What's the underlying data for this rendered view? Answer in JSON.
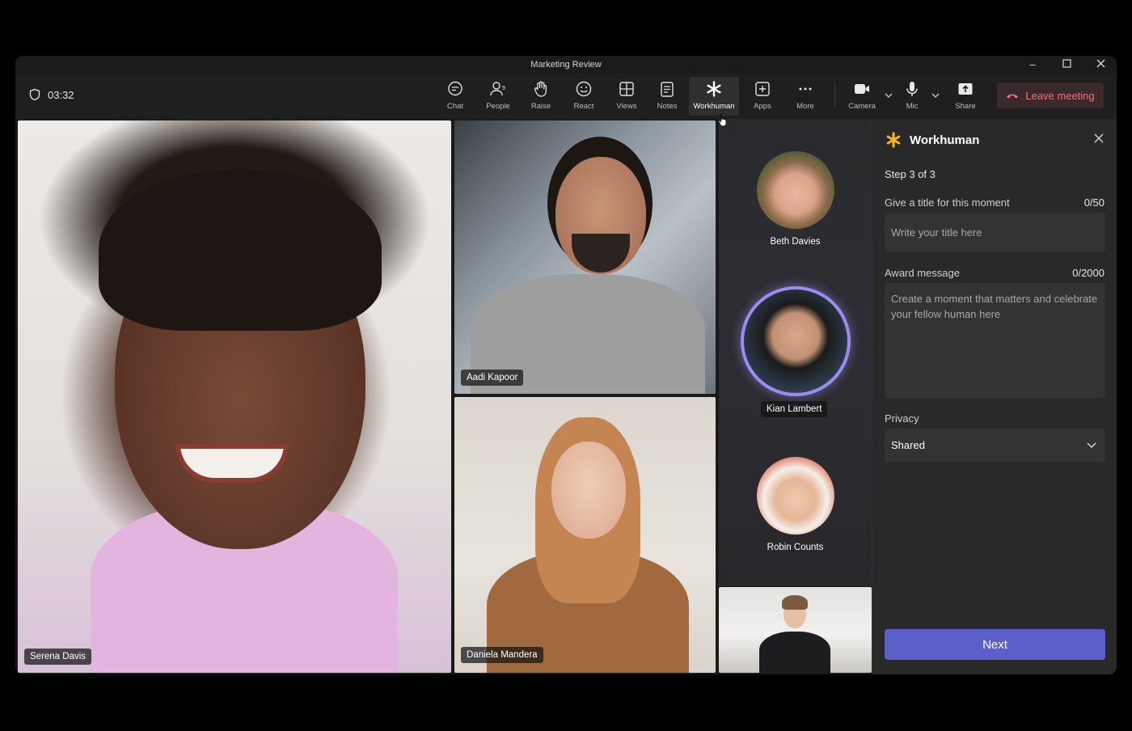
{
  "window": {
    "title": "Marketing Review"
  },
  "toolbar": {
    "timer": "03:32",
    "buttons": {
      "chat": "Chat",
      "people": "People",
      "raise": "Raise",
      "react": "React",
      "views": "Views",
      "notes": "Notes",
      "workhuman": "Workhuman",
      "apps": "Apps",
      "more": "More",
      "camera": "Camera",
      "mic": "Mic",
      "share": "Share"
    },
    "leave_label": "Leave meeting"
  },
  "participants": {
    "main": "Serena Davis",
    "top": "Aadi Kapoor",
    "bottom": "Daniela Mandera",
    "rail": [
      "Beth Davies",
      "Kian Lambert",
      "Robin Counts"
    ]
  },
  "panel": {
    "title": "Workhuman",
    "step": "Step 3 of 3",
    "title_label": "Give a title for this moment",
    "title_count": "0/50",
    "title_placeholder": "Write your title here",
    "message_label": "Award message",
    "message_count": "0/2000",
    "message_placeholder": "Create a moment that matters and celebrate your fellow human here",
    "privacy_label": "Privacy",
    "privacy_value": "Shared",
    "next_label": "Next"
  },
  "colors": {
    "accent": "#5b5fc7",
    "leave": "#f0727e",
    "speaking_ring": "#9b8cf2",
    "workhuman_star": "#f5b71f"
  },
  "icons": [
    "shield-icon",
    "chat-icon",
    "people-icon",
    "hand-icon",
    "smiley-icon",
    "grid-icon",
    "notes-icon",
    "asterisk-icon",
    "plus-square-icon",
    "ellipsis-icon",
    "camera-icon",
    "mic-icon",
    "share-icon",
    "phone-hangup-icon",
    "close-icon",
    "chevron-down-icon"
  ]
}
